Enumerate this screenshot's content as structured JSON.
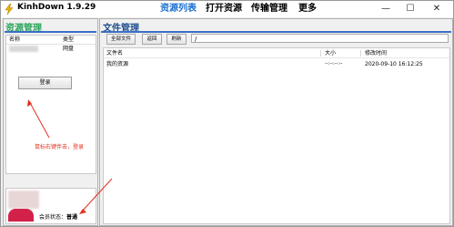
{
  "titlebar": {
    "app_title": "KinhDown 1.9.29",
    "menu": [
      "资源列表",
      "打开资源",
      "传输管理",
      "更多"
    ],
    "controls": [
      "—",
      "☐",
      "✕"
    ]
  },
  "left_panel": {
    "title": "资源管理",
    "columns": [
      "名称",
      "类型"
    ],
    "rows": [
      {
        "name": "",
        "type": "网盘"
      }
    ],
    "login_button": "登录",
    "annotation": "鼠标右键伴击，登录",
    "member_label": "会员状态：",
    "member_status": "普通"
  },
  "right_panel": {
    "title": "文件管理",
    "toolbar": {
      "all_files": "全部文件",
      "back": "返回",
      "refresh": "刷新",
      "path": "/"
    },
    "columns": [
      "文件名",
      "大小",
      "修改时间"
    ],
    "rows": [
      {
        "name": "我的资源",
        "size": "--:--:--:--",
        "modified": "2020-09-10 16:12:25"
      }
    ]
  },
  "colors": {
    "accent_blue": "#1a6fd1",
    "green_title": "#2aa55a",
    "annotation_red": "#e0301e"
  }
}
